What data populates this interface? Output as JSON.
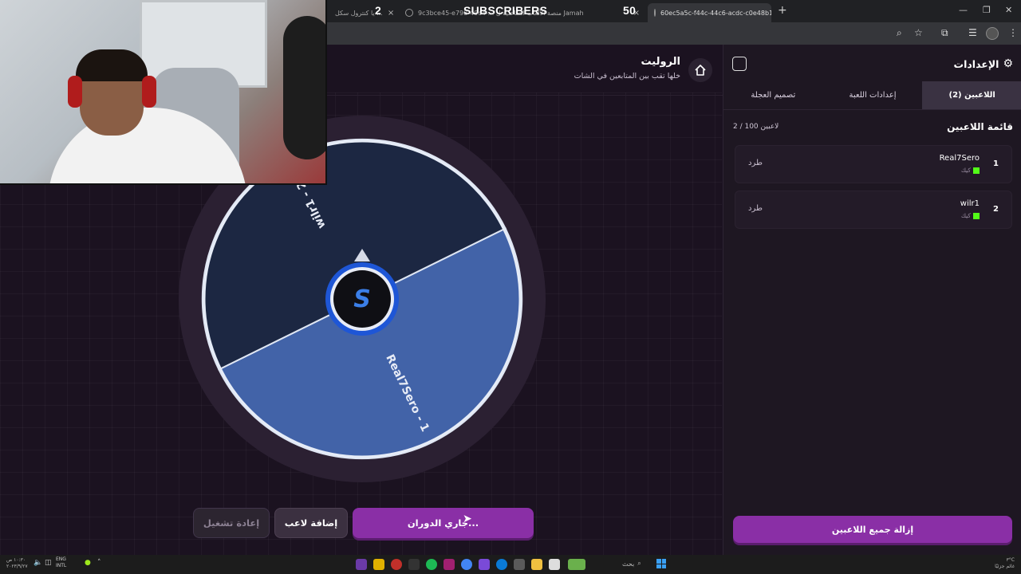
{
  "browser": {
    "overlay_counter_left": "2",
    "overlay_label": "SUBSCRIBERS",
    "overlay_counter_right": "50",
    "tabs": [
      {
        "title": "يا كنترول سكل ..."
      },
      {
        "title": "9c3bce45-e798-49c4-... منصة الألعاب التفاعلية ل Jamah"
      },
      {
        "title": "60ec5a5c-f44c-44c6-acdc-c0e48b1e4fb8 -"
      }
    ]
  },
  "main": {
    "title": "الروليت",
    "subtitle": "خلها تقب بين المتابعين في الشات"
  },
  "wheel": {
    "segments": [
      {
        "label": "Real7Sero - 1",
        "color": "#4263a8"
      },
      {
        "label": "wilr1 - 2",
        "color": "#1c2742"
      }
    ],
    "center_logo_letter": "S"
  },
  "buttons": {
    "spin_label": "جاري الدوران...",
    "add_player_label": "إضافة لاعب",
    "reset_label": "إعادة تشغيل"
  },
  "sidebar": {
    "title": "الإعدادات",
    "tabs": [
      {
        "label": "اللاعبين (2)",
        "active": true
      },
      {
        "label": "إعدادات اللعبة",
        "active": false
      },
      {
        "label": "تصميم العجلة",
        "active": false
      }
    ],
    "list_title": "قائمة اللاعبين",
    "list_count": "2 / 100 لاعبين",
    "players": [
      {
        "index": "1",
        "name": "Real7Sero",
        "platform": "كيك",
        "kick_label": "طرد"
      },
      {
        "index": "2",
        "name": "wilr1",
        "platform": "كيك",
        "kick_label": "طرد"
      }
    ],
    "remove_all_label": "إزالة جميع اللاعبين"
  },
  "taskbar": {
    "search_label": "بحث",
    "lang": "ENG",
    "lang_sub": "INTL",
    "time": "١٠:٣٠ ص",
    "date": "٢٠٢٣/٩/٢٧",
    "weather_temp": "٣°C",
    "weather_desc": "غائم جزئيًا"
  },
  "colors": {
    "accent": "#8a2fa6",
    "segment_primary": "#4263a8",
    "segment_secondary": "#1c2742",
    "kick_green": "#53fc18"
  }
}
